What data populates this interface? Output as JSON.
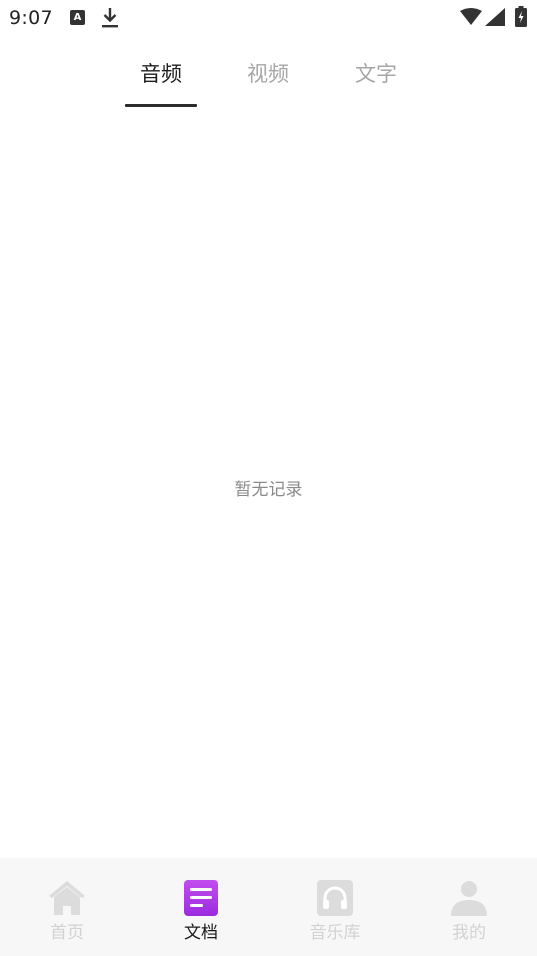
{
  "status_bar": {
    "time": "9:07",
    "notification_letter": "A"
  },
  "tabs": [
    {
      "label": "音频",
      "active": true
    },
    {
      "label": "视频",
      "active": false
    },
    {
      "label": "文字",
      "active": false
    }
  ],
  "empty_state": {
    "message": "暂无记录"
  },
  "bottom_nav": [
    {
      "label": "首页",
      "icon": "home-icon",
      "active": false
    },
    {
      "label": "文档",
      "icon": "document-icon",
      "active": true
    },
    {
      "label": "音乐库",
      "icon": "headphones-icon",
      "active": false
    },
    {
      "label": "我的",
      "icon": "person-icon",
      "active": false
    }
  ],
  "colors": {
    "active_icon_gradient_start": "#c24dee",
    "active_icon_gradient_end": "#9b2be0",
    "inactive_icon": "#dcdcdc",
    "nav_background": "#f7f7f7"
  }
}
